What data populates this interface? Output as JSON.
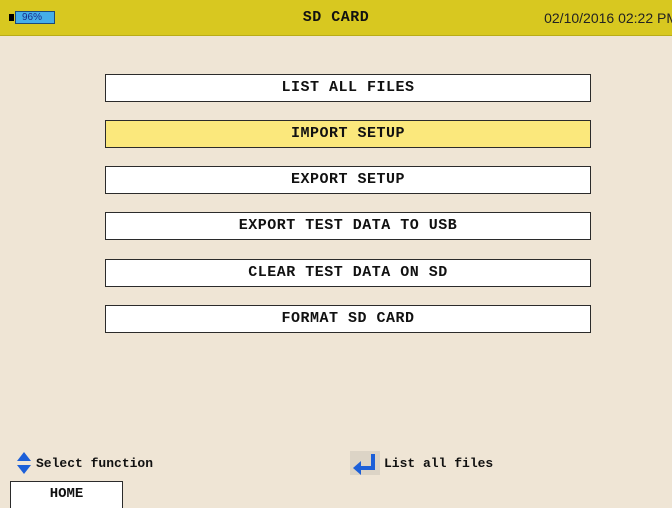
{
  "header": {
    "battery_percent": "96%",
    "title": "SD CARD",
    "datetime": "02/10/2016 02:22 PM"
  },
  "menu": {
    "selected_index": 1,
    "items": [
      {
        "label": "LIST ALL FILES"
      },
      {
        "label": "IMPORT SETUP"
      },
      {
        "label": "EXPORT SETUP"
      },
      {
        "label": "EXPORT TEST DATA TO USB"
      },
      {
        "label": "CLEAR TEST DATA ON SD"
      },
      {
        "label": "FORMAT SD CARD"
      }
    ]
  },
  "hints": {
    "select": {
      "icon": "up-down-arrows-icon",
      "label": "Select function"
    },
    "enter": {
      "icon": "enter-arrow-icon",
      "label": "List all files"
    }
  },
  "footer": {
    "home_label": "HOME"
  },
  "colors": {
    "header_bg": "#d8c820",
    "background": "#efe5d5",
    "selected_item": "#fbe87c",
    "battery": "#45aee8",
    "icon_blue": "#1c5fd8"
  }
}
